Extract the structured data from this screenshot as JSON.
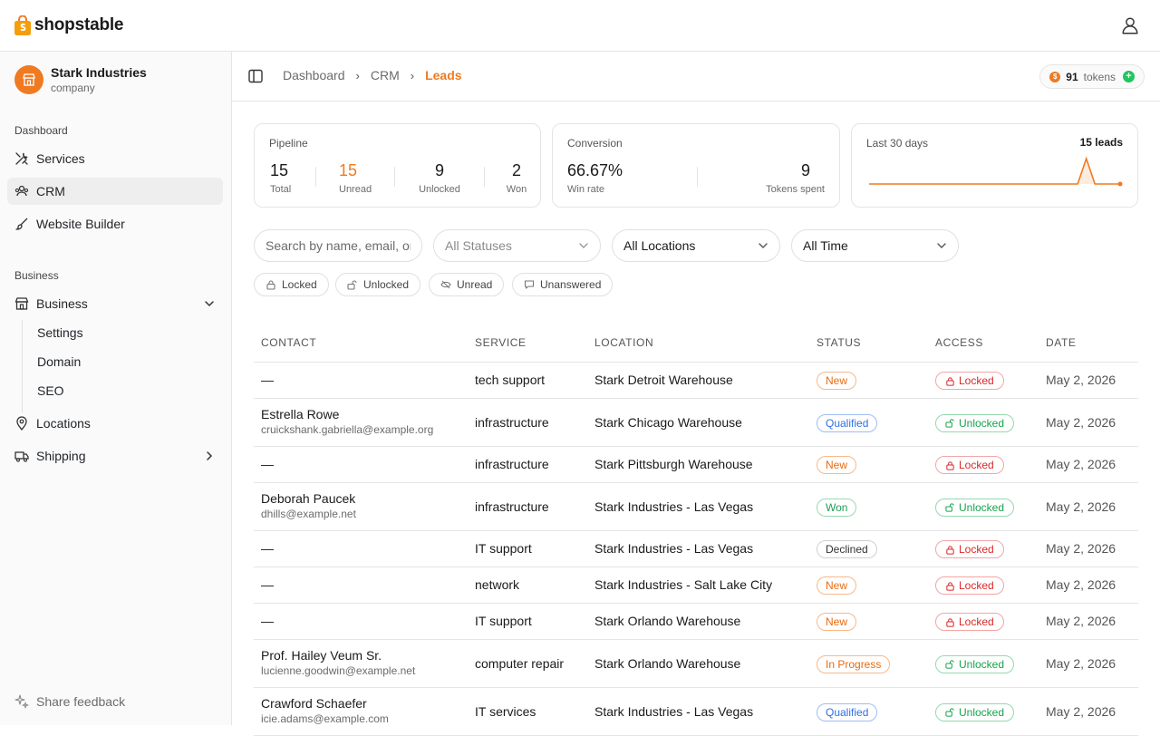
{
  "brand": {
    "name": "shopstable",
    "accent": "#f07a22"
  },
  "company": {
    "name": "Stark Industries",
    "type": "company"
  },
  "sidebar": {
    "section_dashboard": "Dashboard",
    "section_business": "Business",
    "items": [
      {
        "label": "Services",
        "icon": "tools-icon"
      },
      {
        "label": "CRM",
        "icon": "users-icon"
      },
      {
        "label": "Website Builder",
        "icon": "brush-icon"
      },
      {
        "label": "Business",
        "icon": "store-icon"
      },
      {
        "label": "Locations",
        "icon": "map-pin-icon"
      },
      {
        "label": "Shipping",
        "icon": "truck-icon"
      }
    ],
    "sub_items": [
      "Settings",
      "Domain",
      "SEO"
    ],
    "feedback": "Share feedback"
  },
  "breadcrumb": [
    "Dashboard",
    "CRM",
    "Leads"
  ],
  "tokens": {
    "count": "91",
    "label": "tokens"
  },
  "pipeline": {
    "title": "Pipeline",
    "stats": [
      {
        "value": "15",
        "label": "Total"
      },
      {
        "value": "15",
        "label": "Unread"
      },
      {
        "value": "9",
        "label": "Unlocked"
      },
      {
        "value": "2",
        "label": "Won"
      }
    ]
  },
  "conversion": {
    "title": "Conversion",
    "stats": [
      {
        "value": "66.67%",
        "label": "Win rate"
      },
      {
        "value": "9",
        "label": "Tokens spent"
      }
    ]
  },
  "trend": {
    "title": "Last 30 days",
    "summary": "15 leads",
    "values": [
      0,
      0,
      0,
      0,
      0,
      0,
      0,
      0,
      0,
      0,
      0,
      0,
      0,
      0,
      0,
      0,
      0,
      0,
      0,
      0,
      0,
      0,
      0,
      0,
      0,
      15,
      0,
      0,
      0,
      0
    ]
  },
  "filters": {
    "search_placeholder": "Search by name, email, or",
    "status": "All Statuses",
    "location": "All Locations",
    "time": "All Time",
    "chips": [
      "Locked",
      "Unlocked",
      "Unread",
      "Unanswered"
    ]
  },
  "table": {
    "columns": [
      "Contact",
      "Service",
      "Location",
      "Status",
      "Access",
      "Date"
    ],
    "rows": [
      {
        "contact": "—",
        "email": "",
        "service": "tech support",
        "location": "Stark Detroit Warehouse",
        "status": "New",
        "access": "Locked",
        "date": "May 2, 2026"
      },
      {
        "contact": "Estrella Rowe",
        "email": "cruickshank.gabriella@example.org",
        "service": "infrastructure",
        "location": "Stark Chicago Warehouse",
        "status": "Qualified",
        "access": "Unlocked",
        "date": "May 2, 2026"
      },
      {
        "contact": "—",
        "email": "",
        "service": "infrastructure",
        "location": "Stark Pittsburgh Warehouse",
        "status": "New",
        "access": "Locked",
        "date": "May 2, 2026"
      },
      {
        "contact": "Deborah Paucek",
        "email": "dhills@example.net",
        "service": "infrastructure",
        "location": "Stark Industries - Las Vegas",
        "status": "Won",
        "access": "Unlocked",
        "date": "May 2, 2026"
      },
      {
        "contact": "—",
        "email": "",
        "service": "IT support",
        "location": "Stark Industries - Las Vegas",
        "status": "Declined",
        "access": "Locked",
        "date": "May 2, 2026"
      },
      {
        "contact": "—",
        "email": "",
        "service": "network",
        "location": "Stark Industries - Salt Lake City",
        "status": "New",
        "access": "Locked",
        "date": "May 2, 2026"
      },
      {
        "contact": "—",
        "email": "",
        "service": "IT support",
        "location": "Stark Orlando Warehouse",
        "status": "New",
        "access": "Locked",
        "date": "May 2, 2026"
      },
      {
        "contact": "Prof. Hailey Veum Sr.",
        "email": "lucienne.goodwin@example.net",
        "service": "computer repair",
        "location": "Stark Orlando Warehouse",
        "status": "In Progress",
        "access": "Unlocked",
        "date": "May 2, 2026"
      },
      {
        "contact": "Crawford Schaefer",
        "email": "icie.adams@example.com",
        "service": "IT services",
        "location": "Stark Industries - Las Vegas",
        "status": "Qualified",
        "access": "Unlocked",
        "date": "May 2, 2026"
      }
    ]
  }
}
